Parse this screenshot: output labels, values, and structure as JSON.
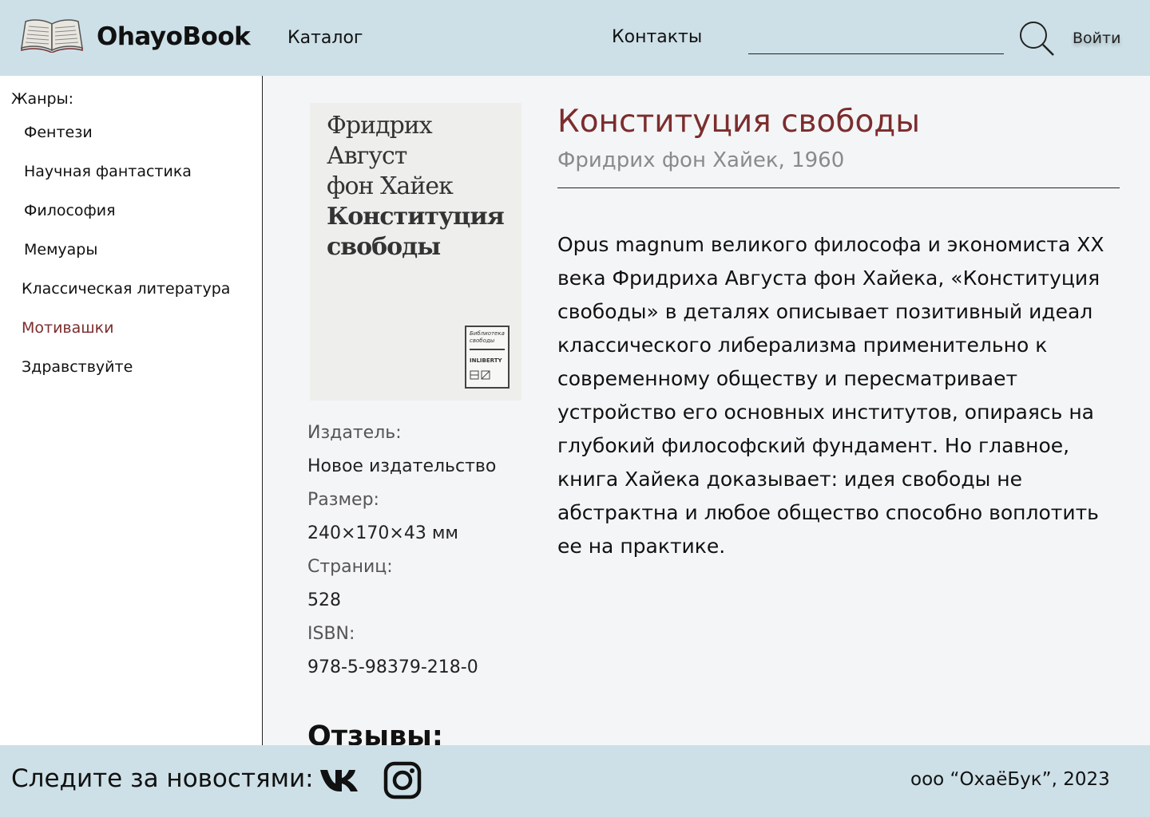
{
  "header": {
    "brand": "OhayoBook",
    "nav": {
      "catalog": "Каталог",
      "contacts": "Контакты"
    },
    "search": {
      "value": "",
      "placeholder": ""
    },
    "login": "Войти"
  },
  "sidebar": {
    "title": "Жанры:",
    "genres": [
      {
        "label": "Фентези"
      },
      {
        "label": "Научная фантастика"
      },
      {
        "label": "Философия"
      },
      {
        "label": "Мемуары"
      },
      {
        "label": "Классическая литература"
      },
      {
        "label": "Мотивашки",
        "active": true
      },
      {
        "label": "Здравствуйте"
      }
    ]
  },
  "book": {
    "cover": {
      "lines": [
        "Фридрих",
        "Август",
        "фон Хайек",
        "Конституция",
        "свободы"
      ],
      "badge_series": "Библиотека свободы",
      "badge_publisher": "INLIBERTY"
    },
    "title": "Конституция свободы",
    "author_year": "Фридрих фон Хайек, 1960",
    "description": "Opus magnum великого философа и экономиста XX века Фридриха Августа фон Хайека, «Конституция свободы» в деталях описывает позитивный идеал классического либерализма применительно к современному обществу и пересматривает устройство его основных институтов, опираясь на глубокий философский фундамент. Но главное, книга Хайека доказывает: идея свободы не абстрактна и любое общество способно воплотить ее на практике.",
    "meta": {
      "publisher_label": "Издатель:",
      "publisher": "Новое издательство",
      "size_label": "Размер:",
      "size": "240×170×43 мм",
      "pages_label": "Страниц:",
      "pages": "528",
      "isbn_label": "ISBN:",
      "isbn": "978-5-98379-218-0"
    },
    "reviews_heading": "Отзывы:"
  },
  "footer": {
    "follow": "Следите за новостями:",
    "copyright": "ооо “ОхаёБук”, 2023"
  },
  "colors": {
    "header_bg": "#cde0e7",
    "accent": "#7b2d2d",
    "main_bg": "#f4f5f7"
  },
  "icons": [
    "book-logo-icon",
    "search-icon",
    "vk-icon",
    "instagram-icon"
  ]
}
